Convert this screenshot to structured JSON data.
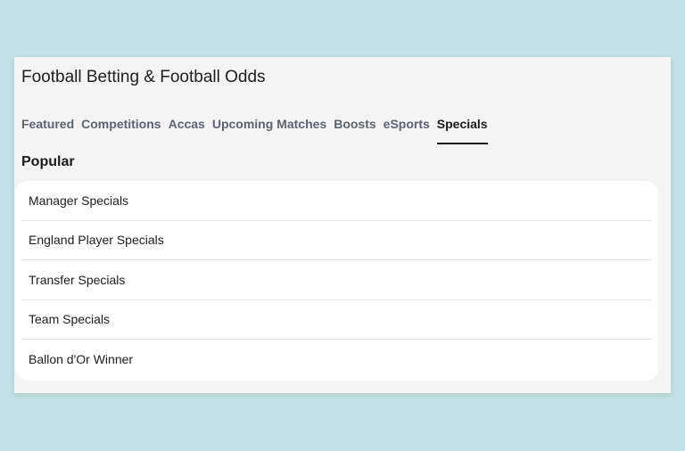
{
  "header": {
    "title": "Football Betting & Football Odds"
  },
  "tabs": [
    {
      "label": "Featured",
      "active": false
    },
    {
      "label": "Competitions",
      "active": false
    },
    {
      "label": "Accas",
      "active": false
    },
    {
      "label": "Upcoming Matches",
      "active": false
    },
    {
      "label": "Boosts",
      "active": false
    },
    {
      "label": "eSports",
      "active": false
    },
    {
      "label": "Specials",
      "active": true
    }
  ],
  "section": {
    "title": "Popular"
  },
  "items": [
    {
      "label": "Manager Specials"
    },
    {
      "label": "England Player Specials"
    },
    {
      "label": "Transfer Specials"
    },
    {
      "label": "Team Specials"
    },
    {
      "label": "Ballon d'Or Winner"
    }
  ],
  "colors": {
    "page_background": "#c4e1e6",
    "panel_background": "#f4f4f4",
    "active_tab": "#1a1a1a",
    "inactive_tab": "#5b6470"
  }
}
